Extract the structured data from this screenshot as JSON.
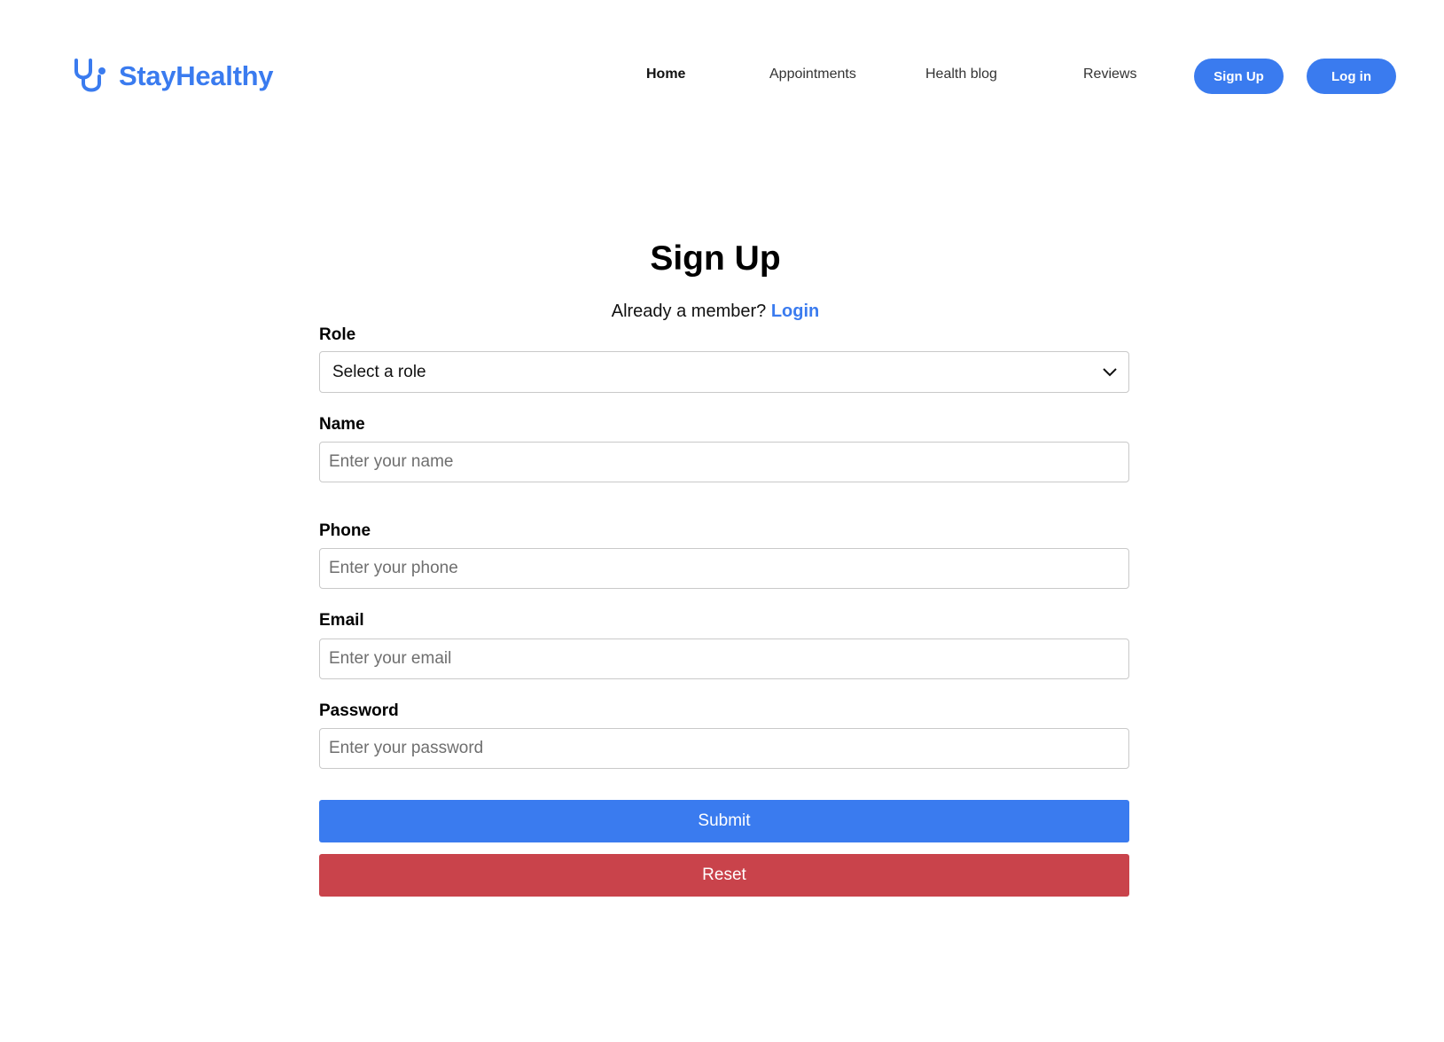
{
  "brand": {
    "name": "StayHealthy",
    "icon": "stethoscope-icon",
    "color": "#3a7bef"
  },
  "nav": {
    "links": [
      "Home",
      "Appointments",
      "Health blog",
      "Reviews"
    ],
    "signup_label": "Sign Up",
    "login_label": "Log in"
  },
  "form": {
    "title": "Sign Up",
    "member_text": "Already a member?",
    "login_link": "Login",
    "role": {
      "label": "Role",
      "selected": "Select a role"
    },
    "name": {
      "label": "Name",
      "placeholder": "Enter your name"
    },
    "phone": {
      "label": "Phone",
      "placeholder": "Enter your phone"
    },
    "email": {
      "label": "Email",
      "placeholder": "Enter your email"
    },
    "password": {
      "label": "Password",
      "placeholder": "Enter your password"
    },
    "submit_label": "Submit",
    "reset_label": "Reset"
  },
  "colors": {
    "accent": "#3a7bef",
    "danger": "#c9434b"
  }
}
